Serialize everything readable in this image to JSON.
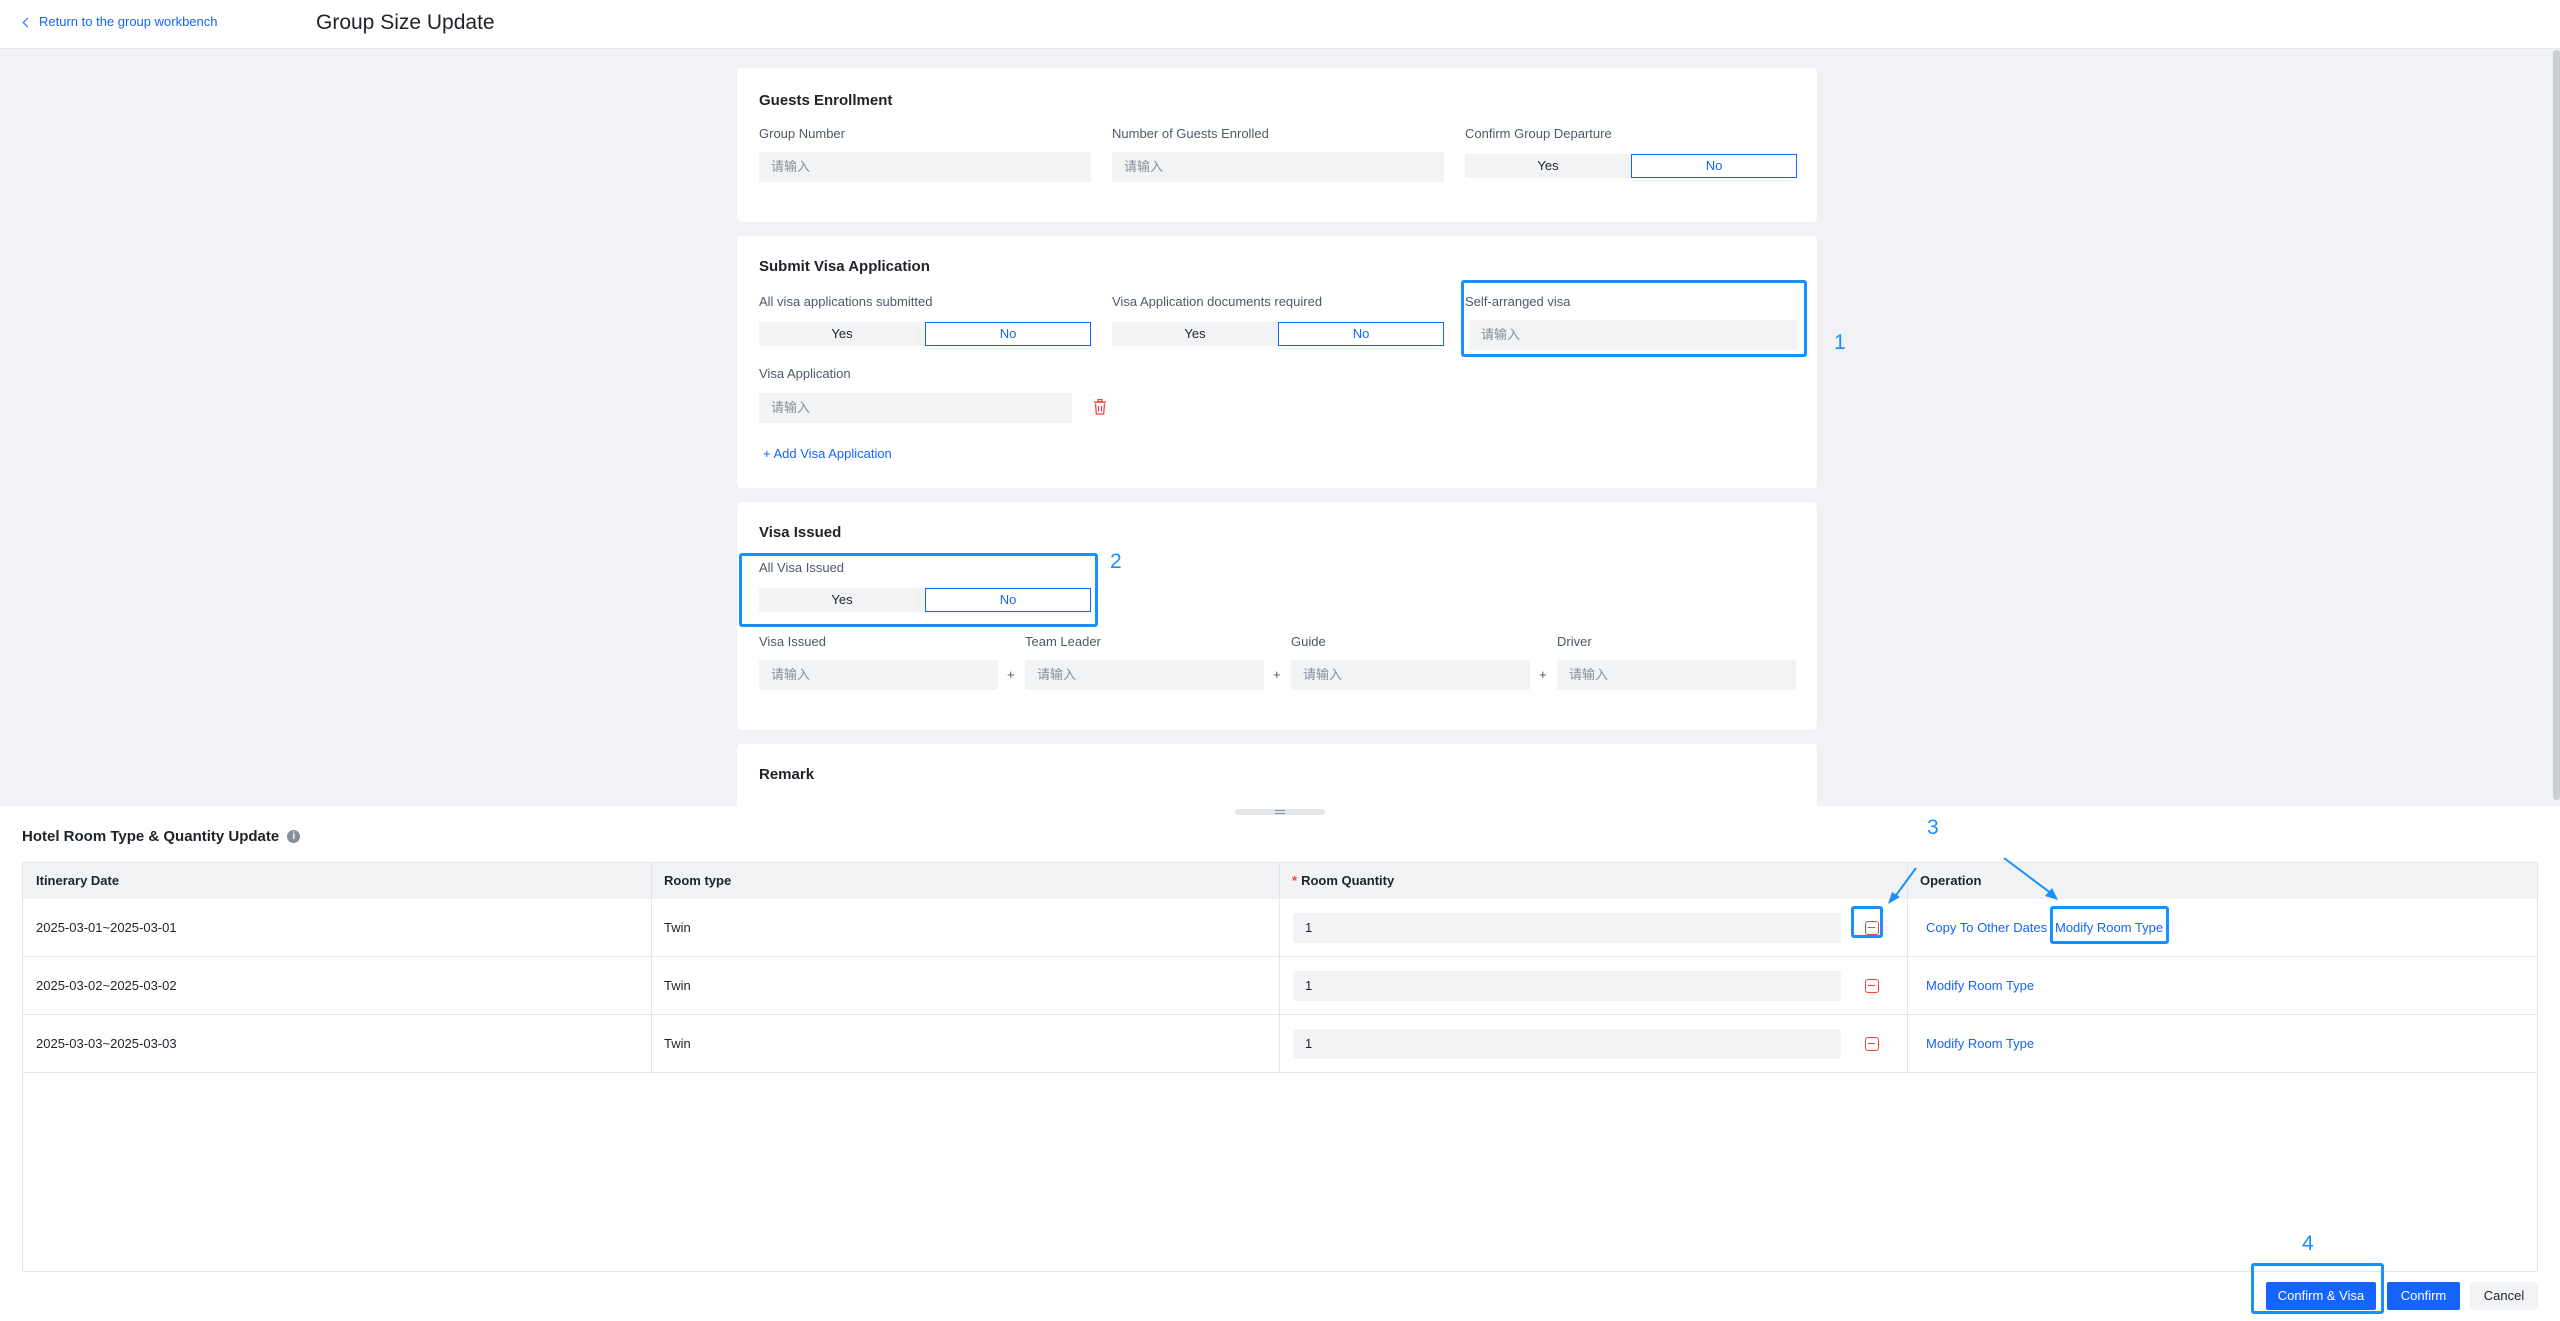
{
  "header": {
    "back_link": "Return to the group workbench",
    "title": "Group Size Update"
  },
  "guests_enrollment": {
    "title": "Guests Enrollment",
    "group_number": {
      "label": "Group Number",
      "placeholder": "请输入"
    },
    "guests_enrolled": {
      "label": "Number of Guests Enrolled",
      "placeholder": "请输入"
    },
    "confirm_departure": {
      "label": "Confirm Group Departure",
      "yes": "Yes",
      "no": "No",
      "selected": "No"
    }
  },
  "visa_application": {
    "title": "Submit Visa Application",
    "all_submitted": {
      "label": "All visa applications submitted",
      "yes": "Yes",
      "no": "No",
      "selected": "No"
    },
    "docs_required": {
      "label": "Visa Application documents required",
      "yes": "Yes",
      "no": "No",
      "selected": "No"
    },
    "self_arranged": {
      "label": "Self-arranged visa",
      "placeholder": "请输入"
    },
    "visa_application": {
      "label": "Visa Application",
      "placeholder": "请输入"
    },
    "add_link": "Add Visa Application"
  },
  "visa_issued": {
    "title": "Visa Issued",
    "all_issued": {
      "label": "All Visa Issued",
      "yes": "Yes",
      "no": "No",
      "selected": "No"
    },
    "visa_issued": {
      "label": "Visa Issued",
      "placeholder": "请输入"
    },
    "team_leader": {
      "label": "Team Leader",
      "placeholder": "请输入"
    },
    "guide": {
      "label": "Guide",
      "placeholder": "请输入"
    },
    "driver": {
      "label": "Driver",
      "placeholder": "请输入"
    },
    "plus": "+"
  },
  "remark": {
    "title": "Remark"
  },
  "hotel": {
    "title": "Hotel Room Type & Quantity Update",
    "info_icon": "i",
    "columns": [
      "Itinerary Date",
      "Room type",
      "Room Quantity",
      "Operation"
    ],
    "required_mark": "*",
    "rows": [
      {
        "date": "2025-03-01~2025-03-01",
        "room_type": "Twin",
        "quantity": "1",
        "copy": "Copy To Other Dates",
        "modify": "Modify Room Type"
      },
      {
        "date": "2025-03-02~2025-03-02",
        "room_type": "Twin",
        "quantity": "1",
        "modify": "Modify Room Type"
      },
      {
        "date": "2025-03-03~2025-03-03",
        "room_type": "Twin",
        "quantity": "1",
        "modify": "Modify Room Type"
      }
    ]
  },
  "footer": {
    "confirm_visa": "Confirm & Visa",
    "confirm": "Confirm",
    "cancel": "Cancel"
  },
  "annotations": {
    "n1": "1",
    "n2": "2",
    "n3": "3",
    "n4": "4",
    "color": "#1890ff"
  },
  "colors": {
    "primary": "#1664ff",
    "danger": "#f53f3f",
    "background": "#f0f2f5"
  }
}
